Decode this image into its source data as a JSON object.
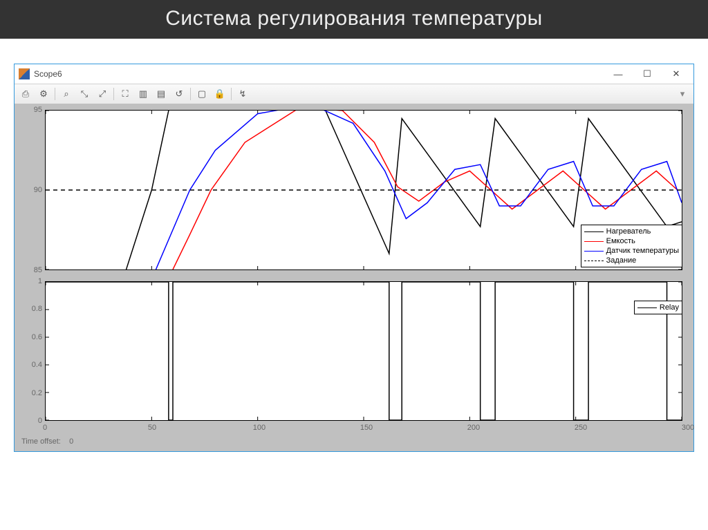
{
  "slide_title": "Система регулирования температуры",
  "window": {
    "title": "Scope6",
    "minimize": "—",
    "maximize": "☐",
    "close": "✕"
  },
  "toolbar": {
    "tools": [
      "print-icon",
      "settings-icon",
      "zoom-in-icon",
      "zoom-x-icon",
      "zoom-y-icon",
      "autoscale-icon",
      "scale-x-axis-icon",
      "scale-y-axis-icon",
      "restore-axes-icon",
      "floating-scope-icon",
      "lock-icon",
      "signal-selector-icon"
    ],
    "glyphs": [
      "⎙",
      "⚙",
      "⌕",
      "⤡",
      "⤢",
      "⛶",
      "▥",
      "▤",
      "↺",
      "▢",
      "🔒",
      "↯"
    ],
    "menu_indicator": "▾"
  },
  "status": {
    "label": "Time offset:",
    "value": "0"
  },
  "chart_data": [
    {
      "type": "line",
      "xlabel": "",
      "ylabel": "",
      "xlim": [
        0,
        300
      ],
      "ylim": [
        85,
        95
      ],
      "xticks": [
        0,
        50,
        100,
        150,
        200,
        250,
        300
      ],
      "yticks": [
        85,
        90,
        95
      ],
      "grid": false,
      "legend_position": "bottom-right",
      "series": [
        {
          "name": "Нагреватель",
          "color": "#000000",
          "x": [
            38,
            50,
            58,
            60,
            120,
            132,
            162,
            168,
            205,
            212,
            249,
            256,
            293,
            300
          ],
          "y": [
            85,
            90,
            95,
            96,
            96,
            95,
            86,
            94.5,
            87.7,
            94.5,
            87.7,
            94.5,
            87.7,
            88.0
          ]
        },
        {
          "name": "Емкость",
          "color": "#ff0000",
          "x": [
            60,
            68,
            78,
            94,
            120,
            140,
            155,
            166,
            176,
            188,
            200,
            210,
            220,
            232,
            244,
            254,
            264,
            276,
            288,
            298
          ],
          "y": [
            85,
            87.2,
            90,
            93.0,
            95.2,
            95.0,
            93.0,
            90.2,
            89.3,
            90.5,
            91.2,
            90.0,
            88.8,
            90.0,
            91.2,
            90.0,
            88.8,
            90.0,
            91.2,
            90.0
          ]
        },
        {
          "name": "Датчик температуры",
          "color": "#0000ff",
          "x": [
            52,
            60,
            68,
            80,
            100,
            125,
            145,
            160,
            170,
            180,
            193,
            205,
            214,
            224,
            237,
            249,
            258,
            268,
            281,
            293,
            300
          ],
          "y": [
            85,
            87.5,
            90,
            92.5,
            94.8,
            95.4,
            94.2,
            91.2,
            88.2,
            89.2,
            91.3,
            91.6,
            89.0,
            89.0,
            91.3,
            91.8,
            89.0,
            89.0,
            91.3,
            91.8,
            89.2
          ]
        },
        {
          "name": "Задание",
          "color": "#000000",
          "dash": true,
          "x": [
            0,
            300
          ],
          "y": [
            90,
            90
          ]
        }
      ]
    },
    {
      "type": "line",
      "xlabel": "",
      "ylabel": "",
      "xlim": [
        0,
        300
      ],
      "ylim": [
        0,
        1
      ],
      "xticks": [
        0,
        50,
        100,
        150,
        200,
        250,
        300
      ],
      "yticks": [
        0,
        0.2,
        0.4,
        0.6,
        0.8,
        1
      ],
      "grid": false,
      "legend_position": "top-right",
      "series": [
        {
          "name": "Relay",
          "color": "#000000",
          "x": [
            0,
            58,
            58,
            60,
            60,
            162,
            162,
            168,
            168,
            205,
            205,
            212,
            212,
            249,
            249,
            256,
            256,
            293,
            293,
            300
          ],
          "y": [
            1,
            1,
            0,
            0,
            1,
            1,
            0,
            0,
            1,
            1,
            0,
            0,
            1,
            1,
            0,
            0,
            1,
            1,
            0,
            0
          ]
        }
      ]
    }
  ]
}
